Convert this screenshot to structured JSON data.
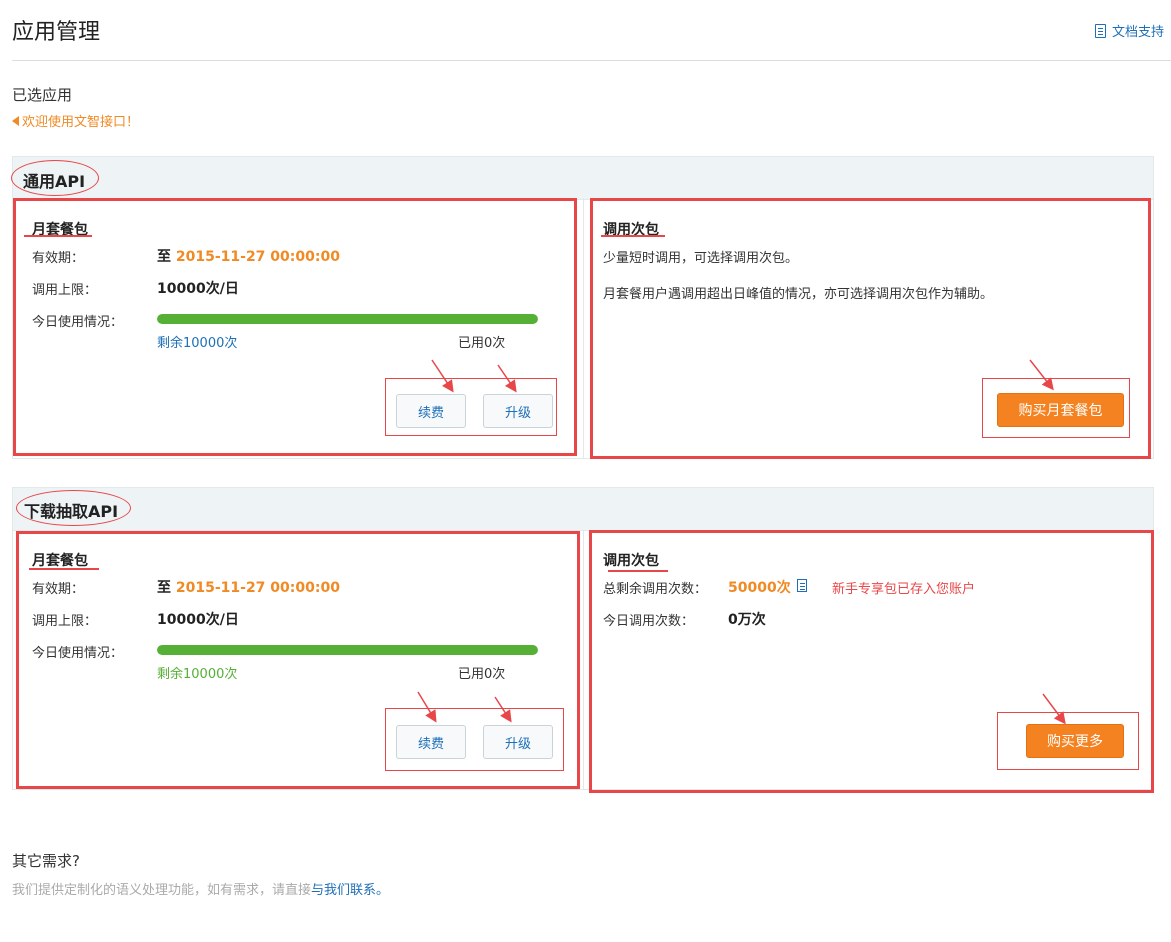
{
  "header": {
    "title": "应用管理",
    "doc_link": "文档支持"
  },
  "selected_label": "已选应用",
  "welcome": "欢迎使用文智接口！",
  "sections": [
    {
      "title": "通用API",
      "monthly": {
        "title": "月套餐包",
        "validity_label": "有效期：",
        "validity_prefix": "至",
        "validity_value": "2015-11-27 00:00:00",
        "limit_label": "调用上限：",
        "limit_value": "10000次/日",
        "usage_label": "今日使用情况：",
        "usage_fraction": 1.0,
        "remain_text": "剩余10000次",
        "used_text": "已用0次",
        "renew_label": "续费",
        "upgrade_label": "升级"
      },
      "pack": {
        "title": "调用次包",
        "line1": "少量短时调用，可选择调用次包。",
        "line2": "月套餐用户遇调用超出日峰值的情况，亦可选择调用次包作为辅助。",
        "buy_label": "购买月套餐包"
      }
    },
    {
      "title": "下载抽取API",
      "monthly": {
        "title": "月套餐包",
        "validity_label": "有效期：",
        "validity_prefix": "至",
        "validity_value": "2015-11-27 00:00:00",
        "limit_label": "调用上限：",
        "limit_value": "10000次/日",
        "usage_label": "今日使用情况：",
        "usage_fraction": 1.0,
        "remain_text": "剩余10000次",
        "used_text": "已用0次",
        "renew_label": "续费",
        "upgrade_label": "升级"
      },
      "pack": {
        "title": "调用次包",
        "total_label": "总剩余调用次数：",
        "total_value": "50000次",
        "note": "新手专享包已存入您账户",
        "today_label": "今日调用次数：",
        "today_value": "0万次",
        "buy_label": "购买更多"
      }
    }
  ],
  "other": {
    "title": "其它需求?",
    "desc": "我们提供定制化的语义处理功能，如有需求，请直接",
    "link": "与我们联系。"
  },
  "colors": {
    "accent_orange": "#f58220",
    "link_blue": "#1e6fb8",
    "annotation_red": "#e8474a",
    "progress_green": "#55b035"
  }
}
